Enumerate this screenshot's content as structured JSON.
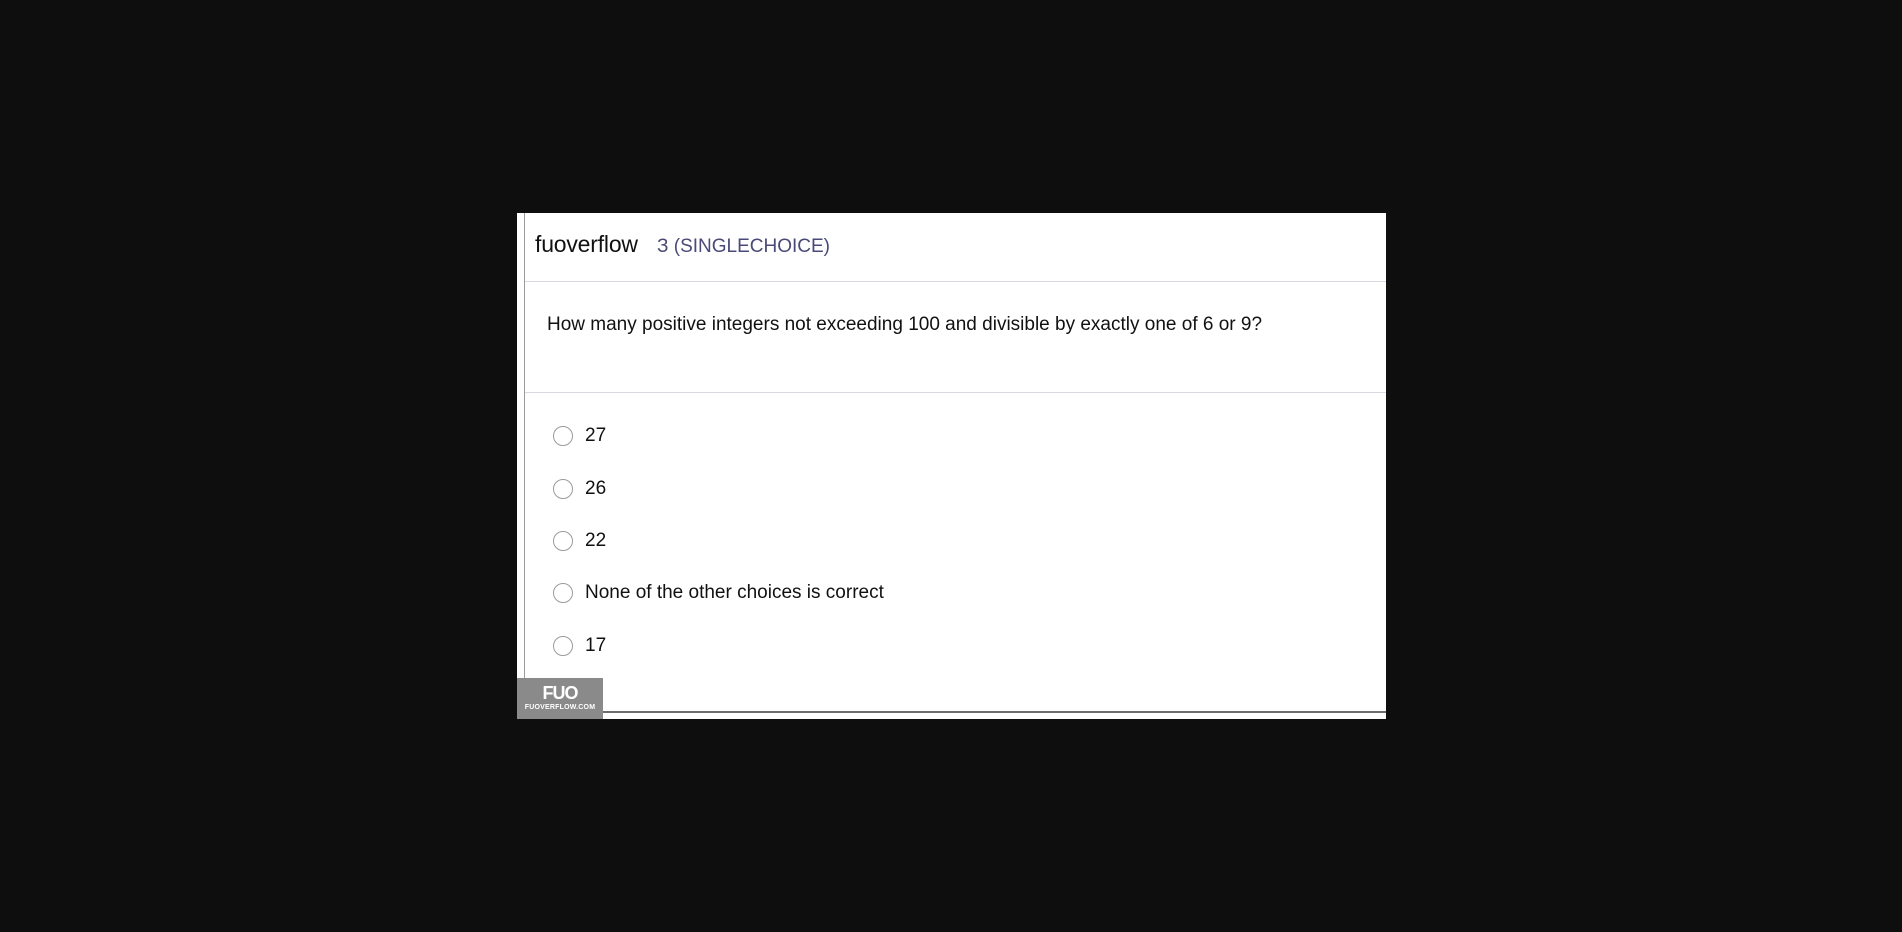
{
  "header": {
    "brand": "fuoverflow",
    "question_type": "З (SINGLECHOICE)"
  },
  "question": {
    "text": "How many positive integers not exceeding 100 and divisible by exactly one of 6 or 9?"
  },
  "options": [
    {
      "label": "27"
    },
    {
      "label": "26"
    },
    {
      "label": "22"
    },
    {
      "label": "None of the other choices is correct"
    },
    {
      "label": "17"
    }
  ],
  "watermark": {
    "logo": "FUO",
    "site": "FUOVERFLOW.COM"
  },
  "colors": {
    "background": "#0e0e0e",
    "card": "#ffffff",
    "question_type": "#4a4a78",
    "divider": "#d7d9e0",
    "watermark": "#8a8a8a"
  }
}
